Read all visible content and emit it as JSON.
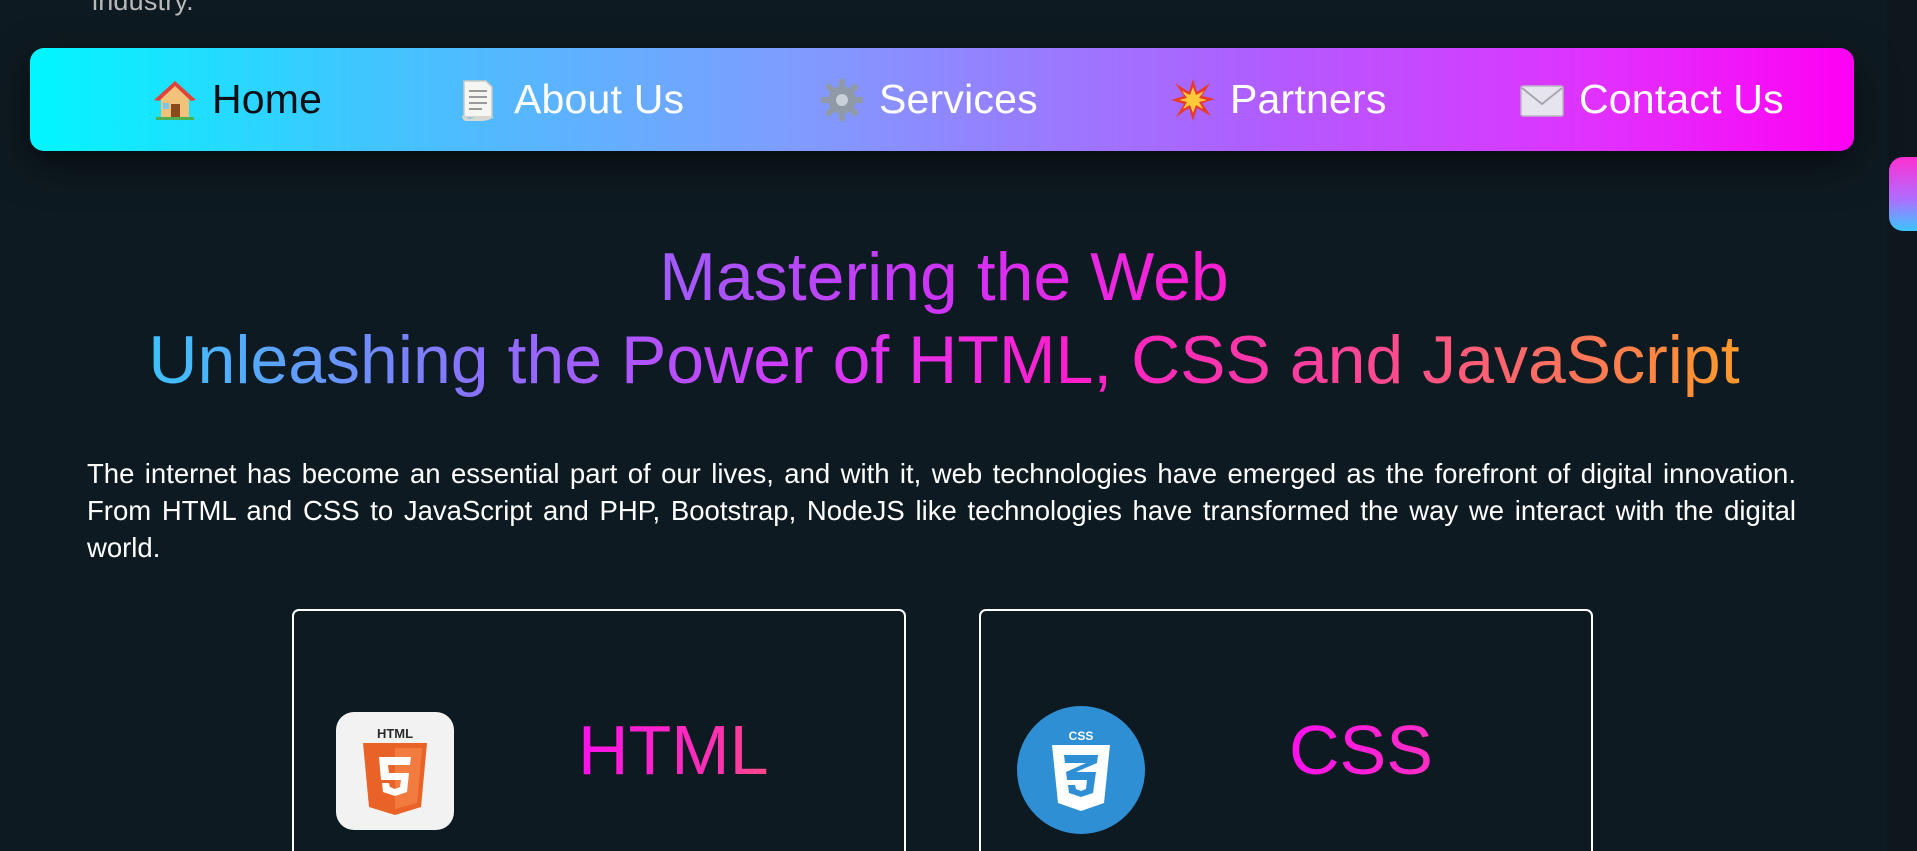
{
  "page": {
    "top_cut_text": "industry."
  },
  "nav": {
    "items": [
      {
        "label": "Home",
        "icon": "house-icon"
      },
      {
        "label": "About Us",
        "icon": "page-icon"
      },
      {
        "label": "Services",
        "icon": "gear-icon"
      },
      {
        "label": "Partners",
        "icon": "collision-icon"
      },
      {
        "label": "Contact Us",
        "icon": "envelope-icon"
      }
    ]
  },
  "hero": {
    "title_line1": "Mastering the Web",
    "title_line2": "Unleashing the Power of HTML, CSS and JavaScript"
  },
  "intro": {
    "paragraph": "The internet has become an essential part of our lives, and with it, web technologies have emerged as the forefront of digital innovation. From HTML and CSS to JavaScript and PHP, Bootstrap, NodeJS like technologies have transformed the way we interact with the digital world."
  },
  "cards": [
    {
      "title": "HTML",
      "logo_text": "HTML",
      "logo_icon": "html5-logo-icon"
    },
    {
      "title": "CSS",
      "logo_text": "CSS",
      "logo_icon": "css3-logo-icon"
    }
  ],
  "colors": {
    "background": "#0e1a21",
    "nav_gradient_start": "#00f7ff",
    "nav_gradient_end": "#ff00f2",
    "accent_pink": "#ff10e8",
    "html_orange": "#e96228",
    "css_blue": "#2f8fd4"
  }
}
